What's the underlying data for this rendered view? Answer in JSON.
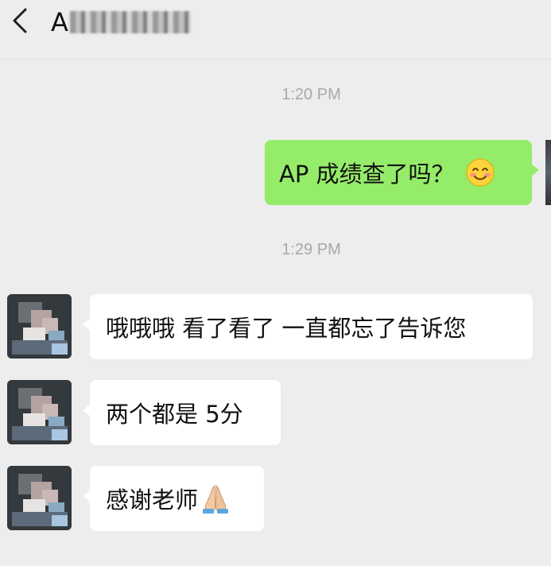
{
  "header": {
    "back_icon": "chevron-left-icon",
    "contact_name_visible": "A"
  },
  "messages": [
    {
      "type": "timestamp",
      "text": "1:20 PM"
    },
    {
      "type": "outgoing",
      "text": "AP 成绩查了吗？",
      "emoji": "smiling-face-icon"
    },
    {
      "type": "timestamp",
      "text": "1:29 PM"
    },
    {
      "type": "incoming",
      "text": "哦哦哦 看了看了 一直都忘了告诉您"
    },
    {
      "type": "incoming",
      "text": "两个都是 5分"
    },
    {
      "type": "incoming",
      "text": "感谢老师",
      "emoji": "folded-hands-icon"
    }
  ],
  "colors": {
    "background": "#ededed",
    "outgoing_bubble": "#95ec69",
    "incoming_bubble": "#ffffff",
    "timestamp_text": "#a8a8a8"
  }
}
